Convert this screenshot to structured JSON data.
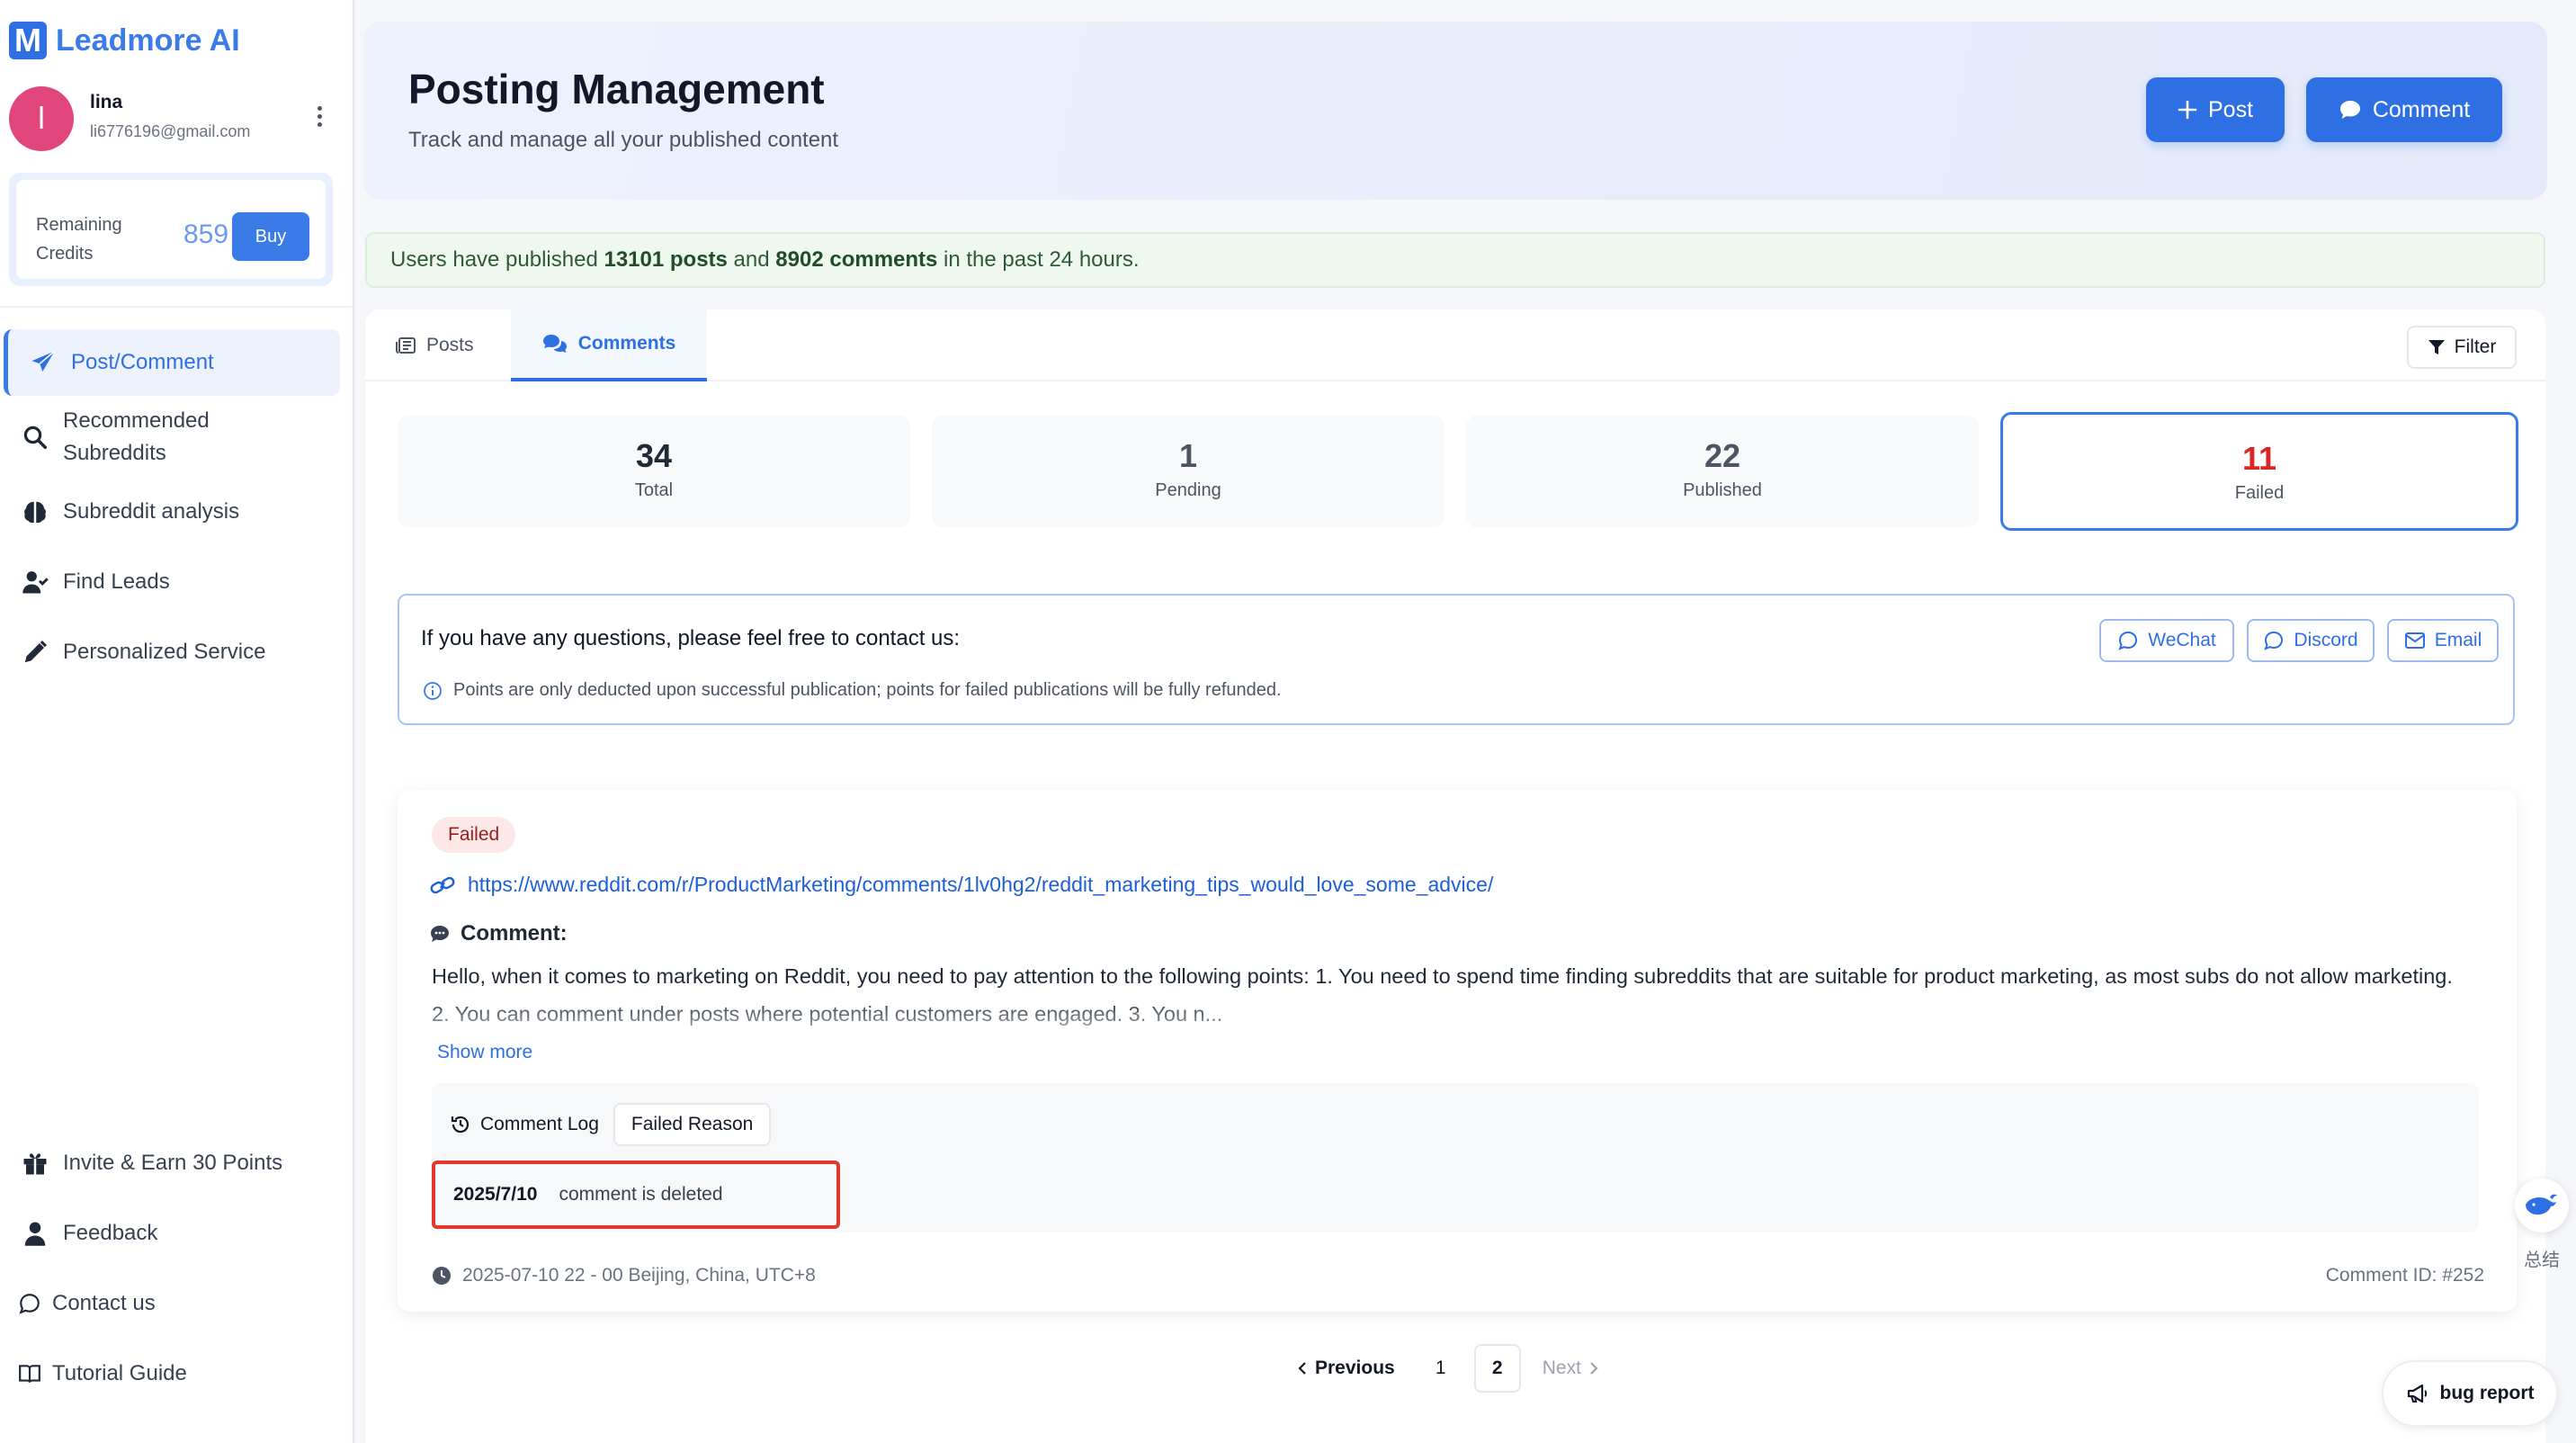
{
  "app": {
    "logo_mark": "M",
    "name": "Leadmore AI"
  },
  "user": {
    "initial": "l",
    "name": "lina",
    "email": "li6776196@gmail.com"
  },
  "credits": {
    "label": "Remaining Credits",
    "value": "859",
    "buy_label": "Buy"
  },
  "nav": {
    "items": [
      {
        "label": "Post/Comment",
        "icon": "paper-plane-icon",
        "active": true
      },
      {
        "label": "Recommended Subreddits",
        "icon": "search-icon"
      },
      {
        "label": "Subreddit analysis",
        "icon": "brain-icon"
      },
      {
        "label": "Find Leads",
        "icon": "user-check-icon"
      },
      {
        "label": "Personalized Service",
        "icon": "pencil-icon"
      }
    ],
    "bottom": [
      {
        "label": "Invite & Earn 30 Points",
        "icon": "gift-icon"
      },
      {
        "label": "Feedback",
        "icon": "user-icon"
      },
      {
        "label": "Contact us",
        "icon": "chat-bubble-icon"
      },
      {
        "label": "Tutorial Guide",
        "icon": "book-icon"
      }
    ]
  },
  "header": {
    "title": "Posting Management",
    "subtitle": "Track and manage all your published content",
    "post_label": "Post",
    "comment_label": "Comment"
  },
  "notice": {
    "prefix": "Users have published ",
    "posts": "13101 posts",
    "middle": " and ",
    "comments": "8902 comments",
    "suffix": " in the past 24 hours."
  },
  "tabs": {
    "posts": "Posts",
    "comments": "Comments",
    "active": "comments"
  },
  "filter_label": "Filter",
  "stats": [
    {
      "value": "34",
      "label": "Total"
    },
    {
      "value": "1",
      "label": "Pending"
    },
    {
      "value": "22",
      "label": "Published"
    },
    {
      "value": "11",
      "label": "Failed",
      "selected": true
    }
  ],
  "contact": {
    "title": "If you have any questions, please feel free to contact us:",
    "note": "Points are only deducted upon successful publication; points for failed publications will be fully refunded.",
    "wechat": "WeChat",
    "discord": "Discord",
    "email": "Email"
  },
  "card": {
    "status": "Failed",
    "link": "https://www.reddit.com/r/ProductMarketing/comments/1lv0hg2/reddit_marketing_tips_would_love_some_advice/",
    "comment_label": "Comment:",
    "comment_text": "Hello, when it comes to marketing on Reddit, you need to pay attention to the following points: 1. You need to spend time finding subreddits that are suitable for product marketing, as most subs do not allow marketing. 2. You can comment under posts where potential customers are engaged. 3. You n...",
    "show_more": "Show more",
    "log_tab": "Comment Log",
    "reason_tab": "Failed Reason",
    "log_date": "2025/7/10",
    "log_message": "comment is deleted",
    "timestamp": "2025-07-10 22 - 00 Beijing, China, UTC+8",
    "comment_id": "Comment ID: #252"
  },
  "pagination": {
    "previous": "Previous",
    "pages": [
      "1",
      "2"
    ],
    "current": "2",
    "next": "Next"
  },
  "widgets": {
    "summary_label": "总结",
    "bug_report": "bug report"
  },
  "colors": {
    "accent": "#2f6fe4",
    "failed": "#dc2626",
    "notice_bg": "#eef8ef",
    "highlight_border": "#e0382b"
  }
}
